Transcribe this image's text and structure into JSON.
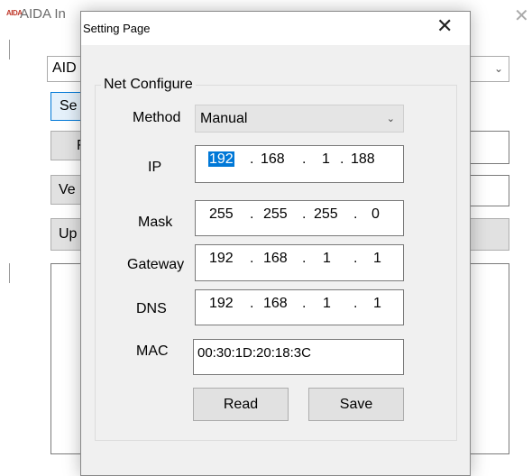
{
  "main_window": {
    "logo_text": "AIDA",
    "title": "AIDA In",
    "combo_value": "AID",
    "button_se": "Se",
    "button_f": "F",
    "button_ve": "Ve",
    "button_up": "Up"
  },
  "dialog": {
    "title": "Setting Page",
    "group_title": "Net Configure",
    "method_label": "Method",
    "method_value": "Manual",
    "ip_label": "IP",
    "ip": [
      "192",
      "168",
      "1",
      "188"
    ],
    "mask_label": "Mask",
    "mask": [
      "255",
      "255",
      "255",
      "0"
    ],
    "gateway_label": "Gateway",
    "gateway": [
      "192",
      "168",
      "1",
      "1"
    ],
    "dns_label": "DNS",
    "dns": [
      "192",
      "168",
      "1",
      "1"
    ],
    "mac_label": "MAC",
    "mac_value": "00:30:1D:20:18:3C",
    "read_button": "Read",
    "save_button": "Save",
    "dot": "."
  },
  "icons": {
    "close": "close-icon",
    "dropdown": "chevron-down-icon"
  },
  "colors": {
    "selection": "#0078d7",
    "dialog_bg": "#f0f0f0",
    "button_bg": "#e1e1e1"
  }
}
